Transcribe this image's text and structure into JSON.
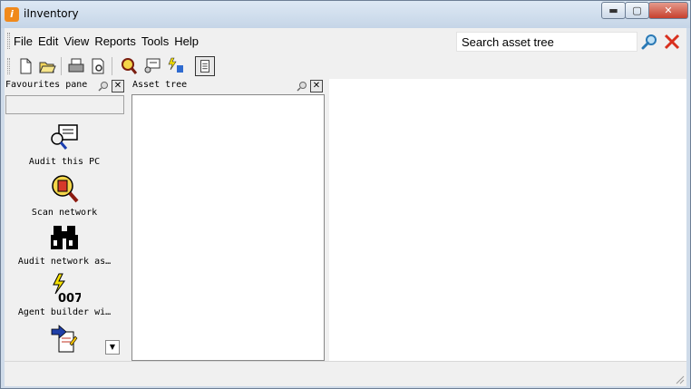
{
  "window": {
    "title": "iInventory",
    "app_icon": "iinventory-logo-icon",
    "controls": {
      "minimize": "▬",
      "maximize": "▢",
      "close": "✕"
    }
  },
  "menu": {
    "items": [
      "File",
      "Edit",
      "View",
      "Reports",
      "Tools",
      "Help"
    ]
  },
  "search": {
    "value": "Search asset tree",
    "search_icon": "magnifier-icon",
    "clear_icon": "red-x-icon"
  },
  "toolbar": {
    "buttons": [
      "new-document-icon",
      "open-folder-icon",
      "print-icon",
      "print-preview-icon",
      "audit-icon",
      "scan-icon",
      "agent-icon",
      "notes-icon"
    ]
  },
  "favourites": {
    "title": "Favourites pane",
    "close_label": "✕",
    "items": [
      {
        "label": "Audit this PC",
        "icon": "audit-pc-icon"
      },
      {
        "label": "Scan network",
        "icon": "scan-network-icon"
      },
      {
        "label": "Audit network as…",
        "icon": "binoculars-icon"
      },
      {
        "label": "Agent builder wi…",
        "icon": "agent-007-icon"
      },
      {
        "label": "",
        "icon": "import-document-icon"
      }
    ],
    "scroll_label": "▼"
  },
  "asset_tree": {
    "title": "Asset tree",
    "close_label": "✕"
  }
}
